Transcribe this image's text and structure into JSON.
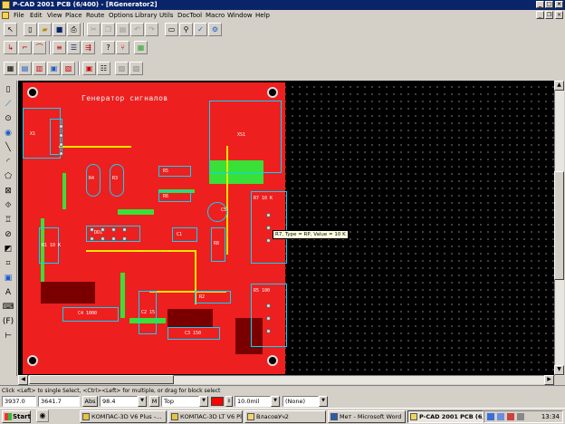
{
  "window": {
    "title": "P-CAD 2001 PCB (6/400) - [RGenerator2]"
  },
  "menu": {
    "items": [
      "File",
      "Edit",
      "View",
      "Place",
      "Route",
      "Options",
      "Library",
      "Utils",
      "DocTool",
      "Macro",
      "Window",
      "Help"
    ]
  },
  "board": {
    "title": "Генератор сигналов",
    "colors": {
      "copper": "#ee1f1f",
      "canvas": "#000000",
      "outline": "#00d8ff",
      "trace_top": "#f7e600",
      "trace_bottom": "#38e038"
    },
    "components": [
      {
        "ref": "X1"
      },
      {
        "ref": "R4"
      },
      {
        "ref": "R3"
      },
      {
        "ref": "R5"
      },
      {
        "ref": "R6"
      },
      {
        "ref": "C5"
      },
      {
        "ref": "R7 10 K"
      },
      {
        "ref": "XS1"
      },
      {
        "ref": "R1 10 K"
      },
      {
        "ref": "DD1"
      },
      {
        "ref": "C1"
      },
      {
        "ref": "R8"
      },
      {
        "ref": "C4 1000"
      },
      {
        "ref": "C2 15"
      },
      {
        "ref": "C3 150"
      },
      {
        "ref": "R2"
      },
      {
        "ref": "R5 100"
      }
    ]
  },
  "tooltip": {
    "text": "R7, Type = RP, Value = 10 K"
  },
  "status": {
    "hint": "Click <Left> to single Select, <Ctrl><Left> for multiple, or drag for block select",
    "x": "3937.0",
    "y": "3641.7",
    "abs_label": "Abs",
    "grid": "98.4",
    "m_label": "M",
    "layer": "Top",
    "layer_color": "#ff0000",
    "width": "10.0mil",
    "net": "(None)"
  },
  "taskbar": {
    "start": "Start",
    "tasks": [
      "КОМПАС-3D V6 Plus -...",
      "КОМПАС-3D LT V6 Plus",
      "ВласовУч2",
      "Мет - Microsoft Word",
      "P-CAD 2001 PCB (6/..."
    ],
    "clock": "13:34"
  }
}
